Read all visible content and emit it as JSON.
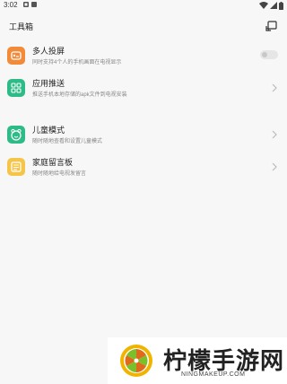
{
  "status_bar": {
    "time": "3:02",
    "icons": [
      "notification-a-icon",
      "notification-b-icon",
      "wifi-icon",
      "signal-icon",
      "battery-icon"
    ]
  },
  "header": {
    "title": "工具箱",
    "cast_icon": "cast-screen-icon"
  },
  "items": [
    {
      "title": "多人投屏",
      "subtitle": "同时支持4个人的手机画面在电视显示",
      "icon": "multi-screen-icon",
      "icon_color": "#f28a3a",
      "control": "toggle",
      "toggle_on": false
    },
    {
      "title": "应用推送",
      "subtitle": "推送手机本地存储的apk文件到电视安装",
      "icon": "apps-grid-icon",
      "icon_color": "#2dbb87",
      "control": "chevron"
    },
    {
      "title": "儿童模式",
      "subtitle": "随时随地查看和设置儿童模式",
      "icon": "child-face-icon",
      "icon_color": "#2dbb87",
      "control": "chevron"
    },
    {
      "title": "家庭留言板",
      "subtitle": "随时随地给电视发留言",
      "icon": "message-board-icon",
      "icon_color": "#f5c54a",
      "control": "chevron"
    }
  ],
  "watermark": {
    "title": "柠檬手游网",
    "url": "NINGMAKEUP.COM",
    "logo_colors": [
      "#f0b400",
      "#e06a1b",
      "#7bbf2a"
    ]
  }
}
